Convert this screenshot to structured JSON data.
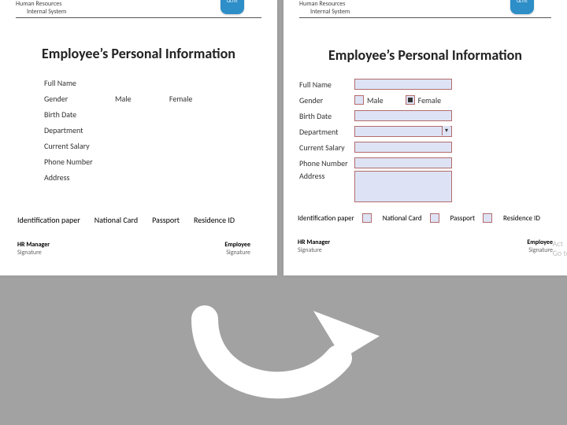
{
  "header": {
    "line1": "Human Resources",
    "line2": "Internal System",
    "badge": "OLITE"
  },
  "title": "Employee’s Personal Information",
  "labels": {
    "fullname": "Full Name",
    "gender": "Gender",
    "birthdate": "Birth Date",
    "department": "Department",
    "salary": "Current Salary",
    "phone": "Phone Number",
    "address": "Address",
    "idpaper": "Identification paper"
  },
  "gender_opts": {
    "male": "Male",
    "female": "Female"
  },
  "id_opts": {
    "national": "National Card",
    "passport": "Passport",
    "residence": "Residence ID"
  },
  "sig_left": {
    "a": "HR Manager",
    "b": "Signature"
  },
  "sig_right": {
    "a": "Employee",
    "b": "Signature"
  },
  "watermark": {
    "a": "Act",
    "b": "Go to"
  }
}
